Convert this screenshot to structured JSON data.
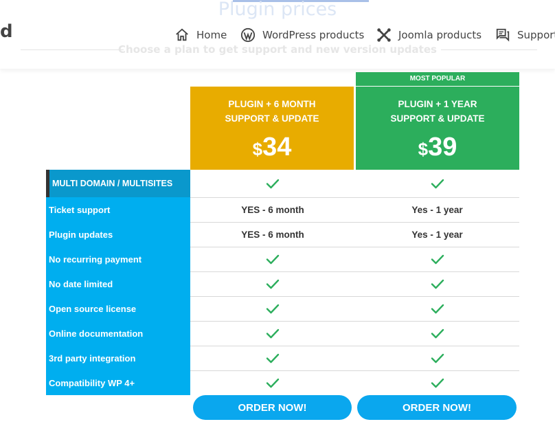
{
  "header": {
    "title": "Plugin prices",
    "subtitle": "Choose a plan to get support and new version updates",
    "logo_fragment": "d",
    "nav": [
      {
        "label": "Home",
        "icon": "home-icon"
      },
      {
        "label": "WordPress products",
        "icon": "wordpress-icon"
      },
      {
        "label": "Joomla products",
        "icon": "joomla-icon"
      },
      {
        "label": "Support",
        "icon": "support-icon"
      }
    ]
  },
  "plans": [
    {
      "name_line1": "PLUGIN + 6 MONTH",
      "name_line2": "SUPPORT & UPDATE",
      "currency": "$",
      "price": "34",
      "color": "#e8ac00",
      "order_label": "ORDER NOW!"
    },
    {
      "name_line1": "PLUGIN + 1 YEAR",
      "name_line2": "SUPPORT & UPDATE",
      "currency": "$",
      "price": "39",
      "color": "#2cae5c",
      "badge": "MOST POPULAR",
      "order_label": "ORDER NOW!"
    }
  ],
  "features": [
    {
      "label": "MULTI DOMAIN / MULTISITES",
      "values": [
        "check",
        "check"
      ]
    },
    {
      "label": "Ticket support",
      "values": [
        "YES - 6 month",
        "Yes - 1 year"
      ]
    },
    {
      "label": "Plugin updates",
      "values": [
        "YES - 6 month",
        "Yes - 1 year"
      ]
    },
    {
      "label": "No recurring payment",
      "values": [
        "check",
        "check"
      ]
    },
    {
      "label": "No date limited",
      "values": [
        "check",
        "check"
      ]
    },
    {
      "label": "Open source license",
      "values": [
        "check",
        "check"
      ]
    },
    {
      "label": "Online documentation",
      "values": [
        "check",
        "check"
      ]
    },
    {
      "label": "3rd party integration",
      "values": [
        "check",
        "check"
      ]
    },
    {
      "label": "Compatibility WP 4+",
      "values": [
        "check",
        "check"
      ]
    }
  ],
  "colors": {
    "feature_bg": "#00aeef",
    "check": "#2cae5c",
    "button": "#0aa7ee"
  }
}
